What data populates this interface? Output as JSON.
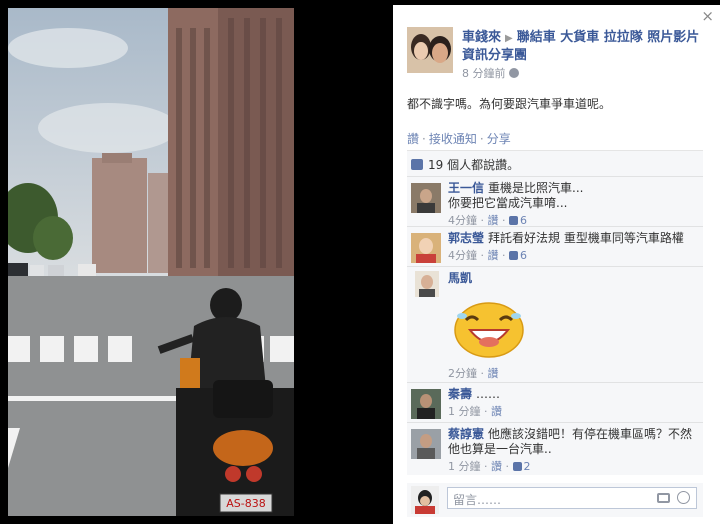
{
  "window": {
    "close_glyph": "×"
  },
  "post": {
    "author": "車錢來",
    "group": "聯結車 大貨車 拉拉隊 照片影片資訊分享團",
    "arrow": "▶",
    "time": "8 分鐘前",
    "text": "都不識字嗎。為何要跟汽車爭車道呢。"
  },
  "actions": {
    "like": "讚",
    "unfollow": "接收通知",
    "share": "分享"
  },
  "likes": {
    "text": "19 個人都說讚。"
  },
  "comments": [
    {
      "name": "王一信",
      "text": "重機是比照汽車...\n你要把它當成汽車唷...",
      "time": "4分鐘",
      "like": "讚",
      "likes": "6"
    },
    {
      "name": "郭志瑩",
      "text": "拜託看好法規 重型機車同等汽車路權",
      "time": "4分鐘",
      "like": "讚",
      "likes": "6"
    },
    {
      "name": "馬凱",
      "text": "",
      "time": "2分鐘",
      "like": "讚",
      "likes": ""
    },
    {
      "name": "秦壽",
      "text": "……",
      "time": "1 分鐘",
      "like": "讚",
      "likes": ""
    },
    {
      "name": "蔡諄憲",
      "text": "他應該沒錯吧！有停在機車區嗎？不然他也算是一台汽車..",
      "time": "1 分鐘",
      "like": "讚",
      "likes": "2"
    }
  ],
  "reply": {
    "placeholder": "留言……"
  },
  "photo": {
    "plate": "AS-838"
  },
  "icons": {
    "close": "close-icon",
    "globe": "globe-icon",
    "like": "like-icon",
    "camera": "camera-icon",
    "emoji": "emoji-icon"
  },
  "colors": {
    "link": "#3b5998",
    "meta": "#9197a3",
    "panel_bg": "#f6f7f9"
  }
}
